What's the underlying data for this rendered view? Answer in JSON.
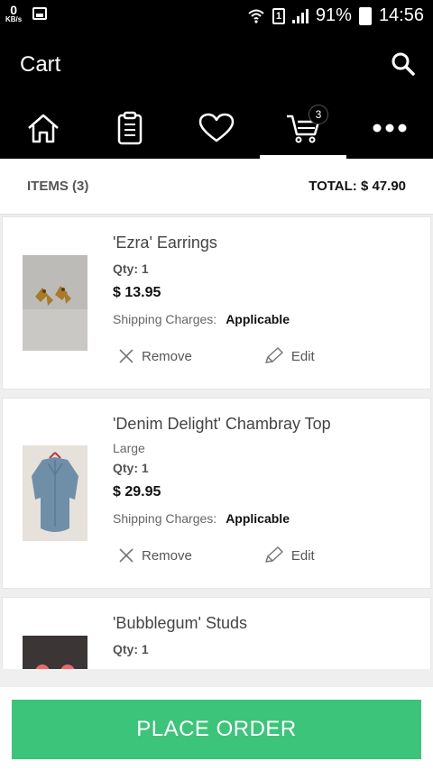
{
  "status_bar": {
    "speed_value": "0",
    "speed_unit": "KB/s",
    "sim": "1",
    "battery": "91%",
    "time": "14:56"
  },
  "header": {
    "title": "Cart",
    "search_icon": "search-icon"
  },
  "tabs": [
    {
      "icon": "home-icon"
    },
    {
      "icon": "clipboard-icon"
    },
    {
      "icon": "heart-icon"
    },
    {
      "icon": "cart-icon",
      "badge": "3",
      "active": true
    },
    {
      "icon": "more-icon"
    }
  ],
  "summary": {
    "items_label": "ITEMS (3)",
    "total_label": "TOTAL: $ 47.90"
  },
  "items": [
    {
      "name": "'Ezra' Earrings",
      "qty": "Qty: 1",
      "price": "$ 13.95",
      "shipping_label": "Shipping Charges:",
      "shipping_value": "Applicable",
      "remove_label": "Remove",
      "edit_label": "Edit"
    },
    {
      "name": "'Denim Delight' Chambray Top",
      "variant": "Large",
      "qty": "Qty: 1",
      "price": "$ 29.95",
      "shipping_label": "Shipping Charges:",
      "shipping_value": "Applicable",
      "remove_label": "Remove",
      "edit_label": "Edit"
    },
    {
      "name": "'Bubblegum' Studs",
      "qty": "Qty: 1"
    }
  ],
  "footer": {
    "place_order_label": "PLACE ORDER"
  },
  "colors": {
    "accent": "#3cc47a",
    "header_bg": "#000000"
  }
}
